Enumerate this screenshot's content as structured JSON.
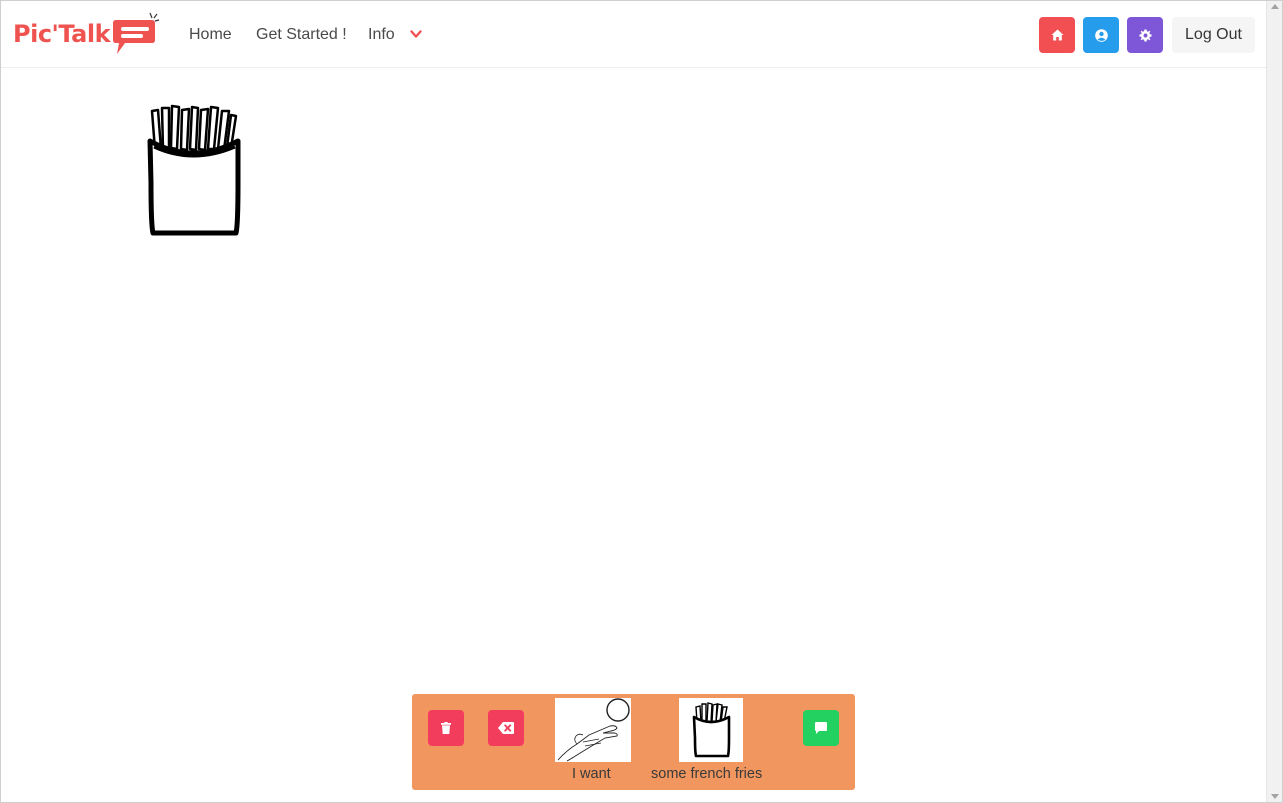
{
  "app": {
    "logo_text": "Pic'Talk"
  },
  "nav": {
    "home": "Home",
    "get_started": "Get Started !",
    "info": "Info",
    "logout": "Log Out"
  },
  "icons": {
    "home_button": "home-icon",
    "account_button": "user-circle-icon",
    "settings_button": "gear-icon",
    "info_dropdown": "chevron-down-icon",
    "trash_button": "trash-icon",
    "backspace_button": "backspace-icon",
    "speak_button": "speech-bubble-icon"
  },
  "colors": {
    "brand": "#ef5350",
    "home_button": "#f14f52",
    "account_button": "#269ced",
    "settings_button": "#7e57d8",
    "logout_button": "#f5f5f5",
    "sentence_bar": "#f0965e",
    "trash_button": "#f23d5c",
    "backspace_button": "#f23d5c",
    "speak_button": "#23d160"
  },
  "main": {
    "pictogram": "french-fries-pictogram"
  },
  "sentence": {
    "items": [
      {
        "label": "I want",
        "pictogram": "i-want-pictogram"
      },
      {
        "label": "some french fries",
        "pictogram": "french-fries-pictogram"
      }
    ]
  }
}
